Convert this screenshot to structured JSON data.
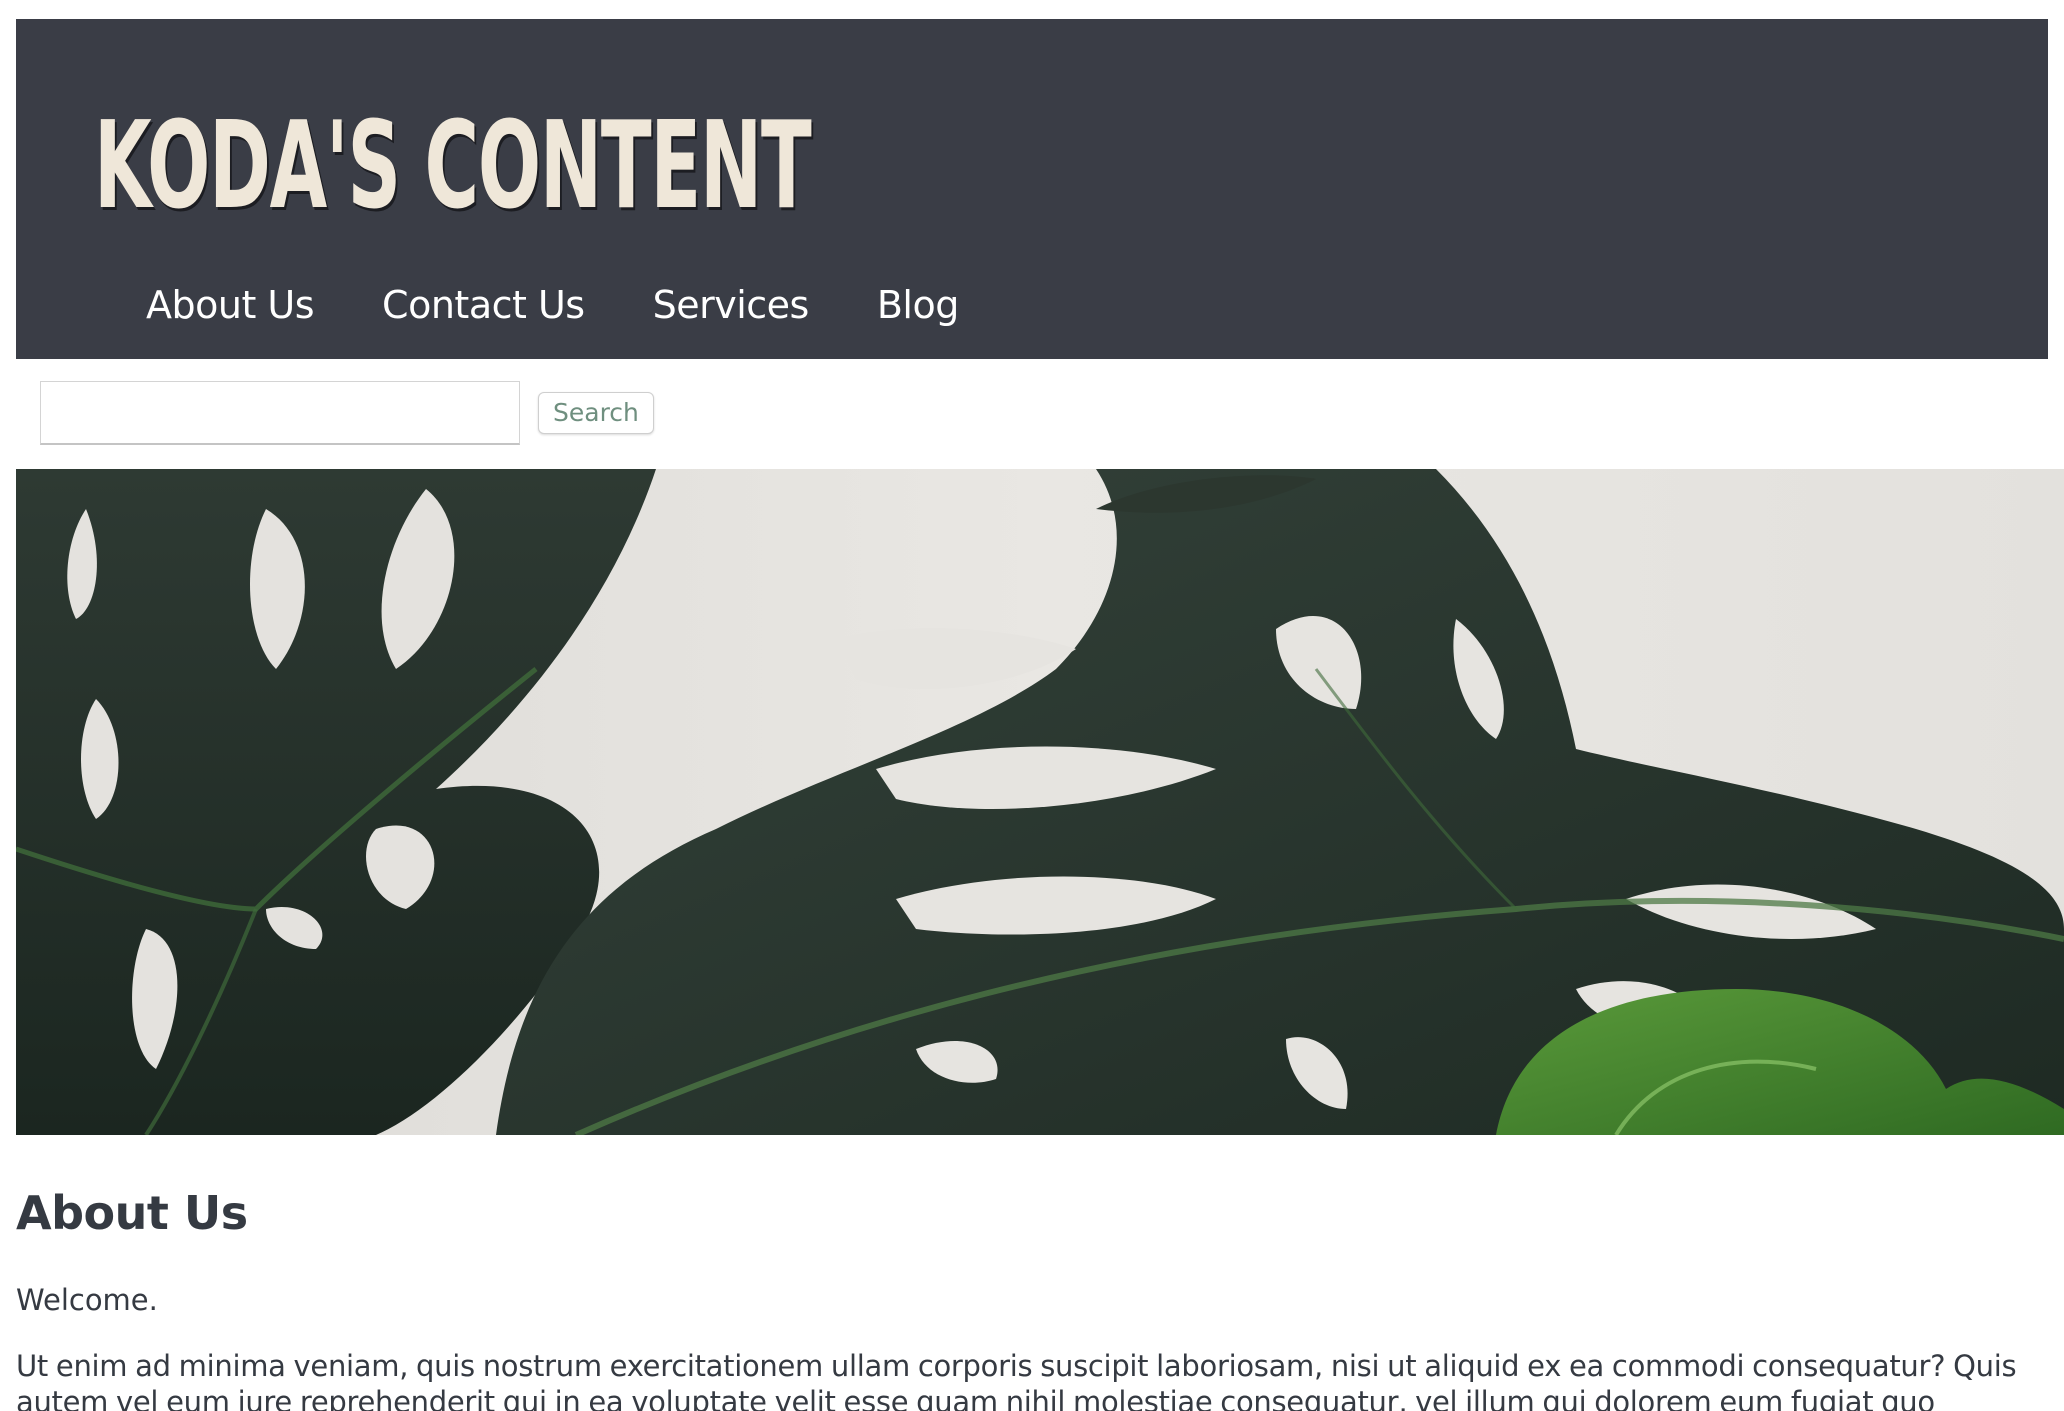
{
  "header": {
    "logo_text": "KODA'S CONTENT",
    "background_color": "#3a3d46",
    "logo_color": "#efe7d9",
    "nav": [
      {
        "label": "About Us"
      },
      {
        "label": "Contact Us"
      },
      {
        "label": "Services"
      },
      {
        "label": "Blog"
      }
    ]
  },
  "search": {
    "input_value": "",
    "button_label": "Search",
    "button_text_color": "#6f8f7f"
  },
  "hero": {
    "image_subject": "monstera-leaves-photo"
  },
  "main": {
    "heading": "About Us",
    "welcome": "Welcome.",
    "paragraph": "Ut enim ad minima veniam, quis nostrum exercitationem ullam corporis suscipit laboriosam, nisi ut aliquid ex ea commodi consequatur? Quis autem vel eum iure reprehenderit qui in ea voluptate velit esse quam nihil molestiae consequatur, vel illum qui dolorem eum fugiat quo",
    "text_color": "#353a42"
  }
}
